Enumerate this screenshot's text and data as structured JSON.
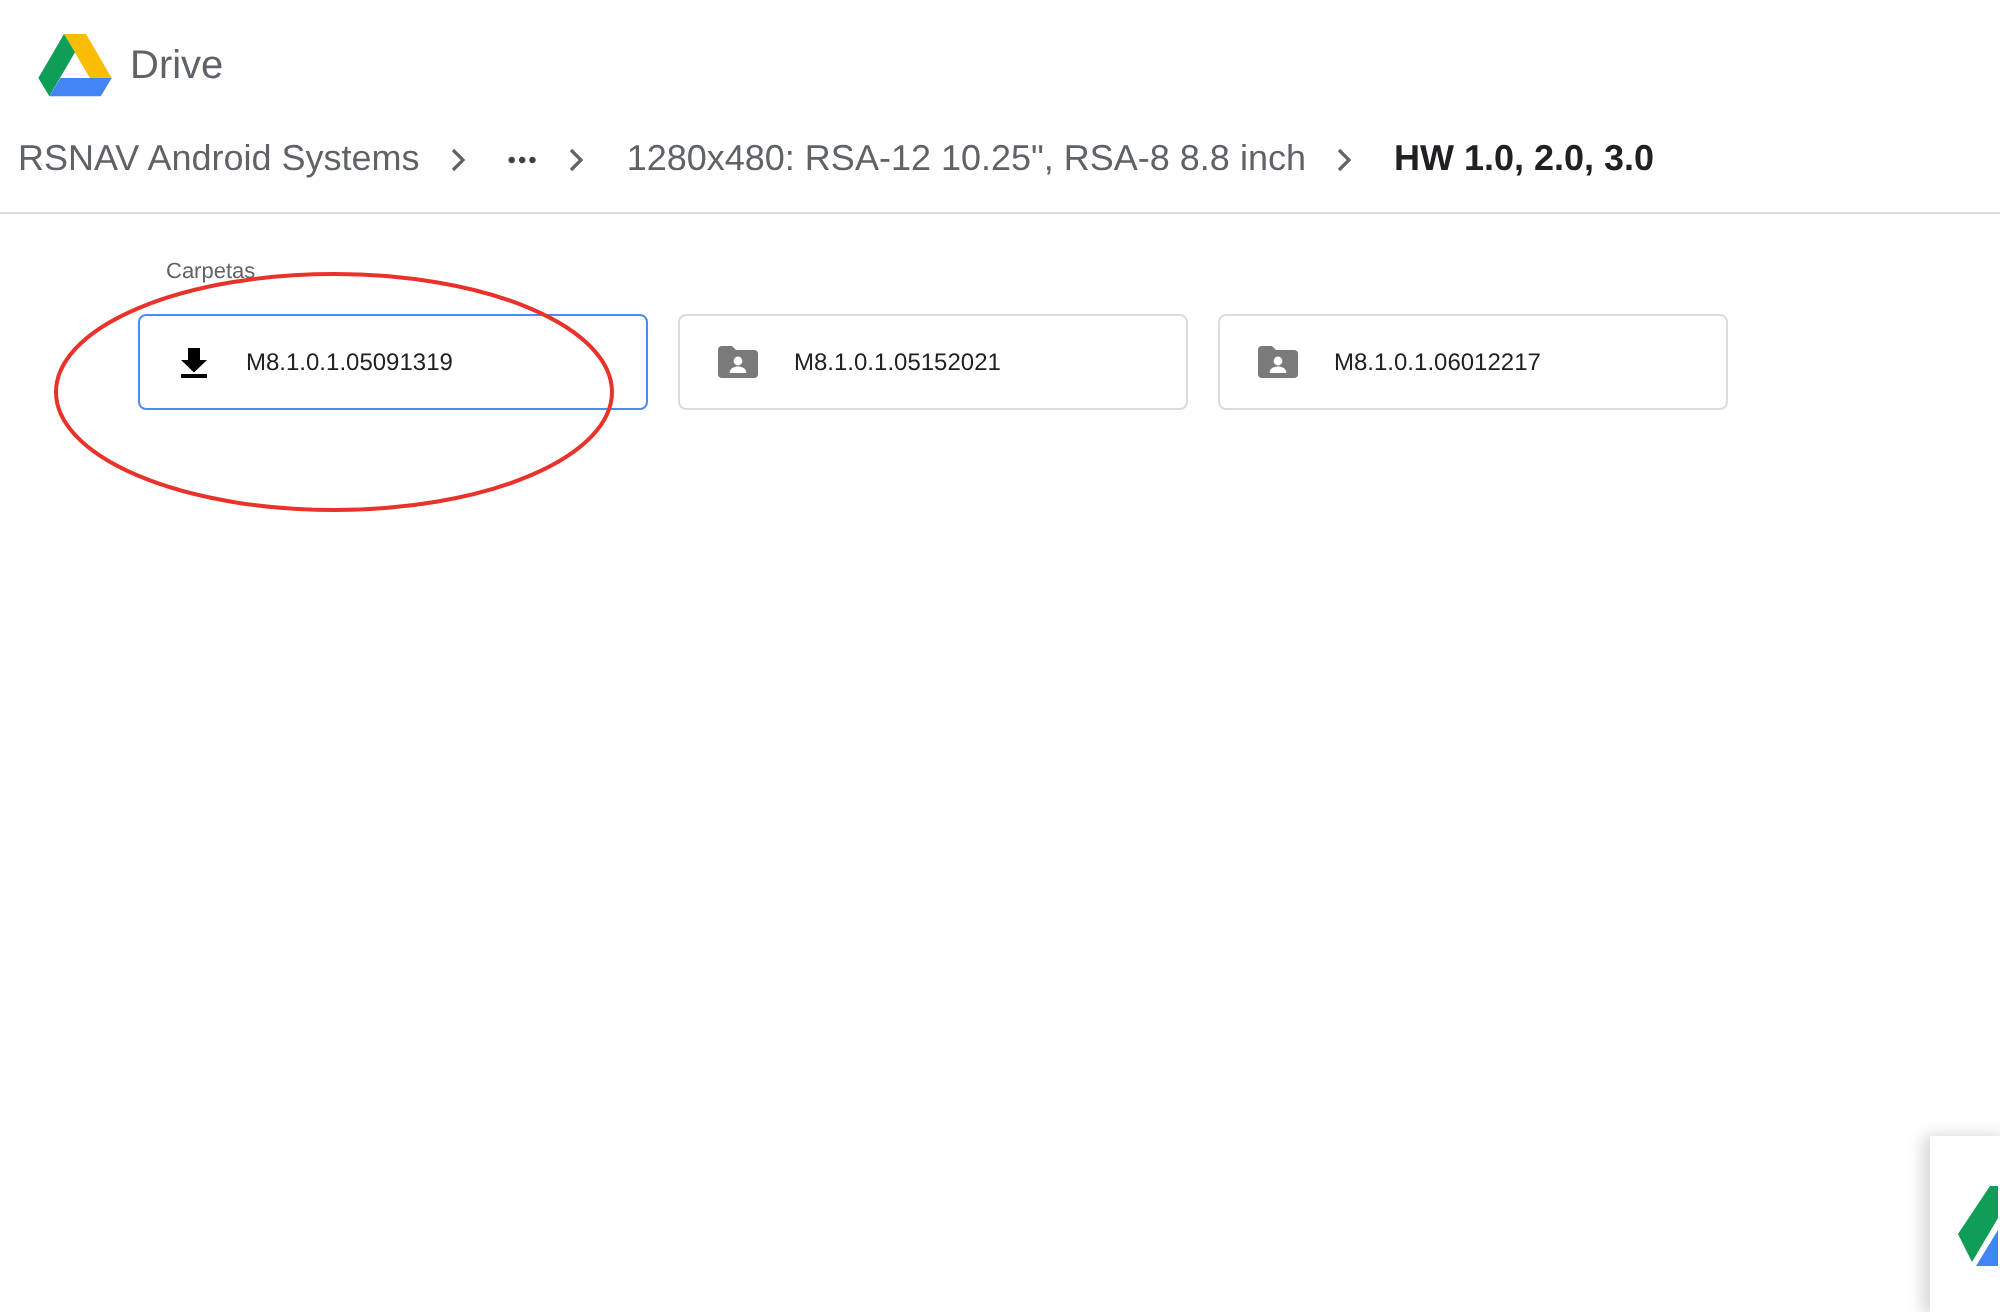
{
  "app": {
    "name": "Drive"
  },
  "breadcrumb": [
    {
      "label": "RSNAV Android Systems",
      "current": false
    },
    {
      "label": "•••",
      "current": false
    },
    {
      "label": "1280x480: RSA-12 10.25\", RSA-8 8.8 inch",
      "current": false
    },
    {
      "label": "HW 1.0, 2.0, 3.0",
      "current": true
    }
  ],
  "section_title": "Carpetas",
  "folders": [
    {
      "name": "M8.1.0.1.05091319",
      "kind": "download",
      "selected": true
    },
    {
      "name": "M8.1.0.1.05152021",
      "kind": "shared",
      "selected": false
    },
    {
      "name": "M8.1.0.1.06012217",
      "kind": "shared",
      "selected": false
    }
  ]
}
